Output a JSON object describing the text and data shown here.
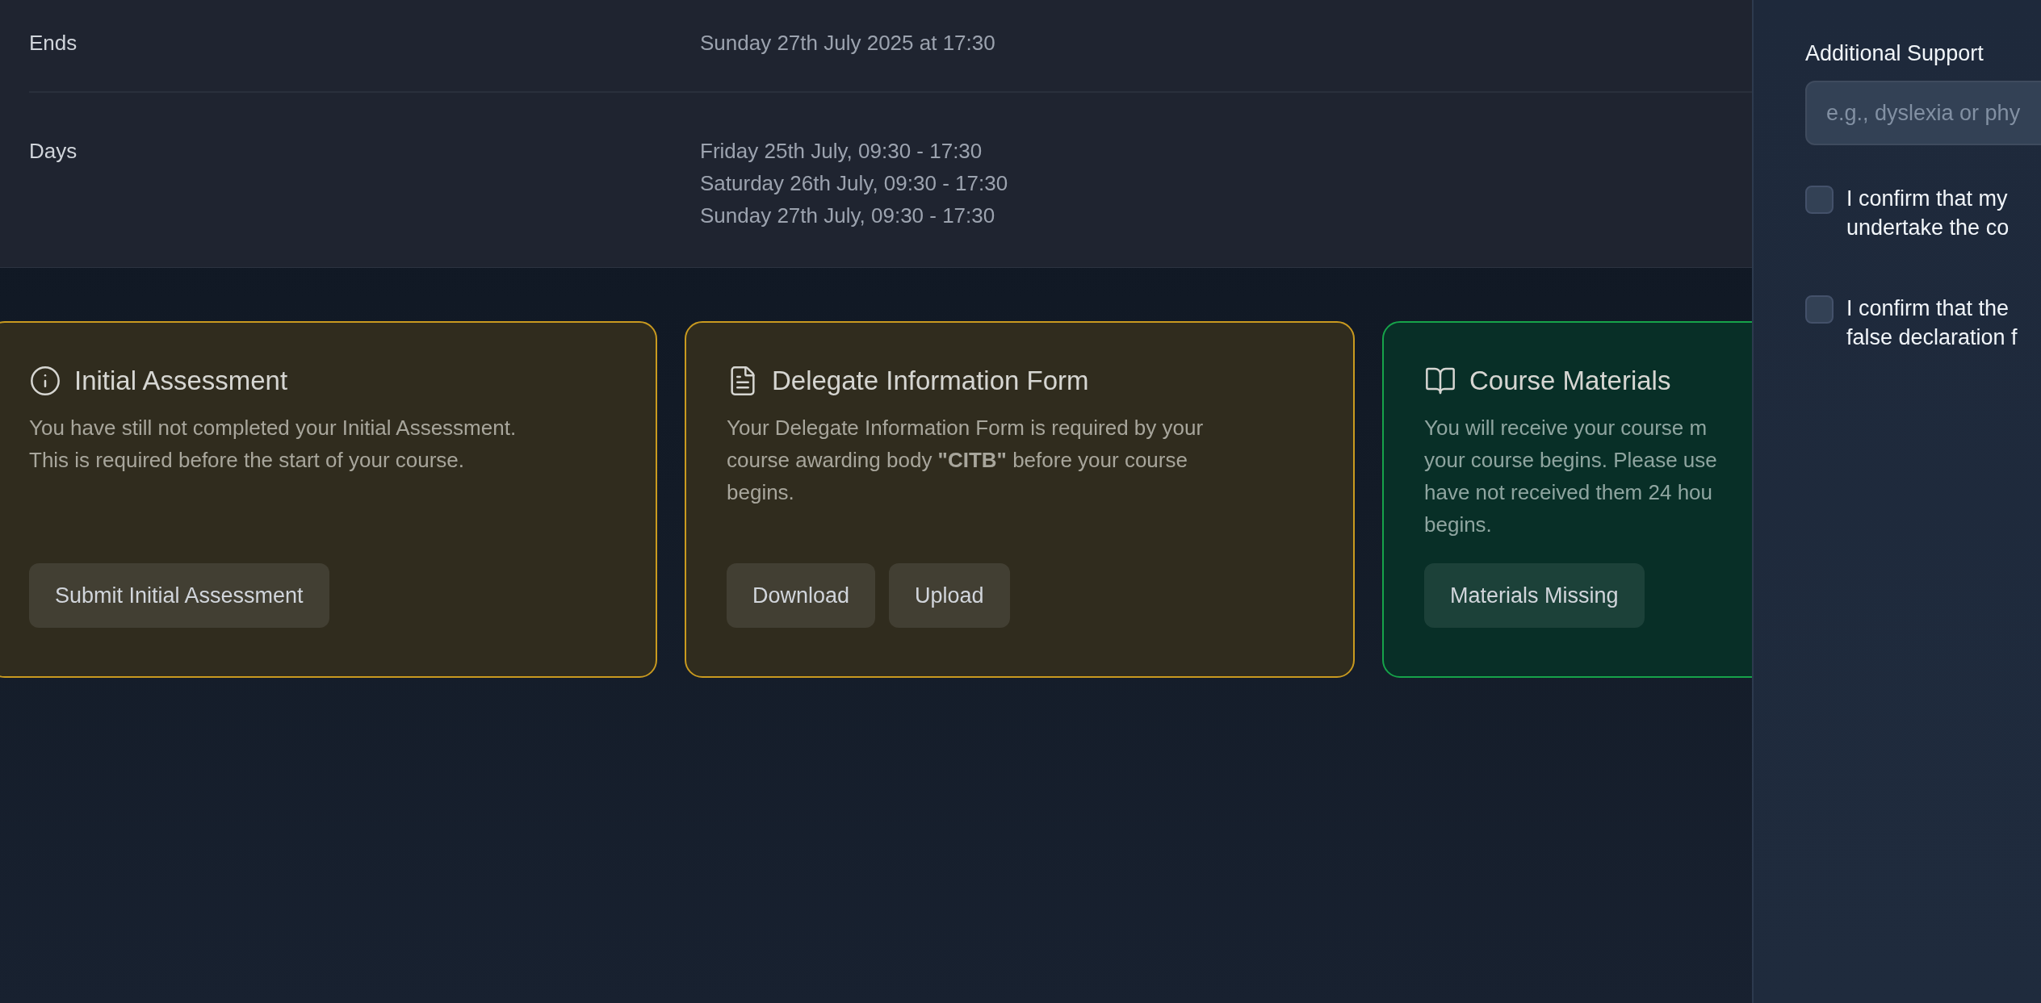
{
  "details": [
    {
      "label": "Ends",
      "values": [
        "Sunday 27th July 2025 at 17:30"
      ]
    },
    {
      "label": "Days",
      "values": [
        "Friday 25th July, 09:30 - 17:30",
        "Saturday 26th July, 09:30 - 17:30",
        "Sunday 27th July, 09:30 - 17:30"
      ]
    }
  ],
  "cards": [
    {
      "kind": "warning",
      "title": "Initial Assessment",
      "body_lines": [
        "You have still not completed your Initial Assessment.",
        "This is required before the start of your course."
      ],
      "buttons": [
        "Submit Initial Assessment"
      ]
    },
    {
      "kind": "warning",
      "title": "Delegate Information Form",
      "body_lines": [
        "Your Delegate Information Form is required by your",
        "course awarding body **\"CITB\"** before your course",
        "begins."
      ],
      "buttons": [
        "Download",
        "Upload"
      ]
    },
    {
      "kind": "success",
      "title": "Course Materials",
      "body_lines": [
        "You will receive your course m",
        "your course begins. Please use",
        "have not received them 24 hou",
        "begins."
      ],
      "buttons": [
        "Materials Missing"
      ]
    }
  ],
  "side_panel": {
    "support_label": "Additional Support",
    "support_placeholder": "e.g., dyslexia or phy",
    "confirmations": [
      {
        "lines": [
          "I confirm that my",
          "undertake the co"
        ],
        "checked": false
      },
      {
        "lines": [
          "I confirm that the",
          "false declaration f"
        ],
        "checked": false
      }
    ]
  }
}
